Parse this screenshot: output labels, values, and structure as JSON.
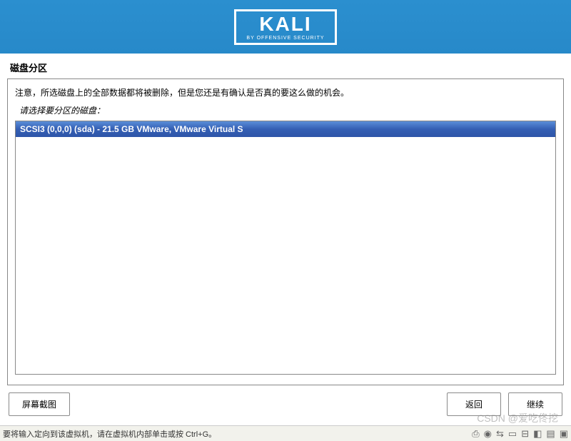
{
  "header": {
    "logo_text": "KALI",
    "logo_subtitle": "BY OFFENSIVE SECURITY"
  },
  "page": {
    "title": "磁盘分区"
  },
  "main": {
    "warning": "注意，所选磁盘上的全部数据都将被删除，但是您还是有确认是否真的要这么做的机会。",
    "instruction": "请选择要分区的磁盘：",
    "disks": [
      {
        "label": "SCSI3 (0,0,0) (sda) - 21.5 GB VMware, VMware Virtual S",
        "selected": true
      }
    ]
  },
  "buttons": {
    "screenshot": "屏幕截图",
    "back": "返回",
    "continue_": "继续"
  },
  "statusbar": {
    "message": "要将输入定向到该虚拟机，请在虚拟机内部单击或按 Ctrl+G。"
  },
  "watermark": "CSDN @爱吃佟挖"
}
